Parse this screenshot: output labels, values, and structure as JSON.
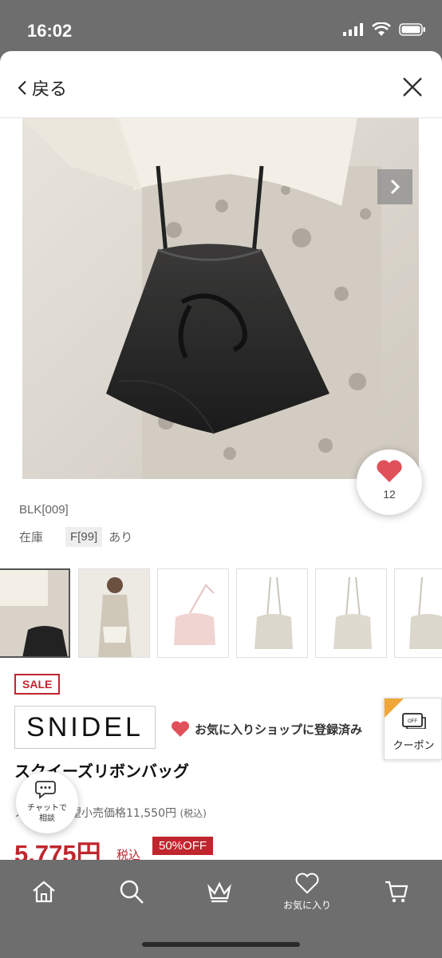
{
  "status_bar": {
    "time": "16:02"
  },
  "nav": {
    "back_label": "戻る"
  },
  "product": {
    "color_code": "BLK[009]",
    "stock_label": "在庫",
    "size": "F[99]",
    "stock_value": "あり",
    "favorites_count": "12",
    "sale_badge": "SALE",
    "brand": "SNIDEL",
    "fav_shop_label": "お気に入りショップに登録済み",
    "name": "スクイーズリボンバッグ",
    "list_price_label": "メーカー希望小売価格11,550円",
    "list_price_tax": "(税込)",
    "sale_price": "5,775円",
    "sale_price_tax": "税込",
    "discount": "50%OFF"
  },
  "coupon": {
    "label": "クーポン"
  },
  "chat": {
    "label_line1": "チャットで",
    "label_line2": "相談"
  },
  "tabbar": {
    "items": [
      {
        "icon": "home-icon",
        "label": ""
      },
      {
        "icon": "search-icon",
        "label": ""
      },
      {
        "icon": "crown-icon",
        "label": ""
      },
      {
        "icon": "heart-icon",
        "label": "お気に入り"
      },
      {
        "icon": "cart-icon",
        "label": ""
      }
    ]
  },
  "colors": {
    "accent_red": "#c0262d",
    "coupon_orange": "#f0a73a",
    "heart": "#e0505a"
  }
}
